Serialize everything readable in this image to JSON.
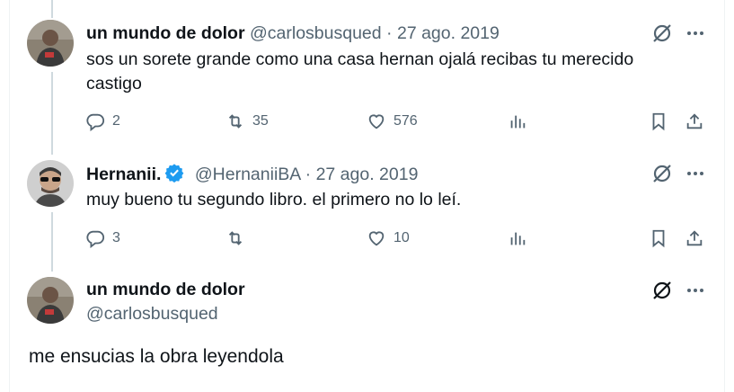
{
  "tweets": [
    {
      "name": "un mundo de dolor",
      "handle": "@carlosbusqued",
      "separator": "·",
      "date": "27 ago. 2019",
      "text_line1": "sos un sorete grande como una casa hernan ojalá recibas tu merecido",
      "text_line2": "castigo",
      "replies": "2",
      "retweets": "35",
      "likes": "576"
    },
    {
      "name": "Hernanii.",
      "verified": true,
      "handle": "@HernaniiBA",
      "separator": "·",
      "date": "27 ago. 2019",
      "text_line1": "muy bueno tu segundo libro. el primero no lo leí.",
      "replies": "3",
      "retweets": "",
      "likes": "10"
    }
  ],
  "main_tweet": {
    "name": "un mundo de dolor",
    "handle": "@carlosbusqued",
    "text": "me ensucias la obra leyendola"
  },
  "colors": {
    "text_primary": "#0f1419",
    "text_secondary": "#536471",
    "verified_blue": "#1d9bf0",
    "thread_line": "#cfd9de"
  },
  "icons": {
    "reply": "reply-icon",
    "retweet": "retweet-icon",
    "like": "heart-icon",
    "views": "views-icon",
    "bookmark": "bookmark-icon",
    "share": "share-icon",
    "grok": "grok-icon",
    "more": "more-icon"
  }
}
